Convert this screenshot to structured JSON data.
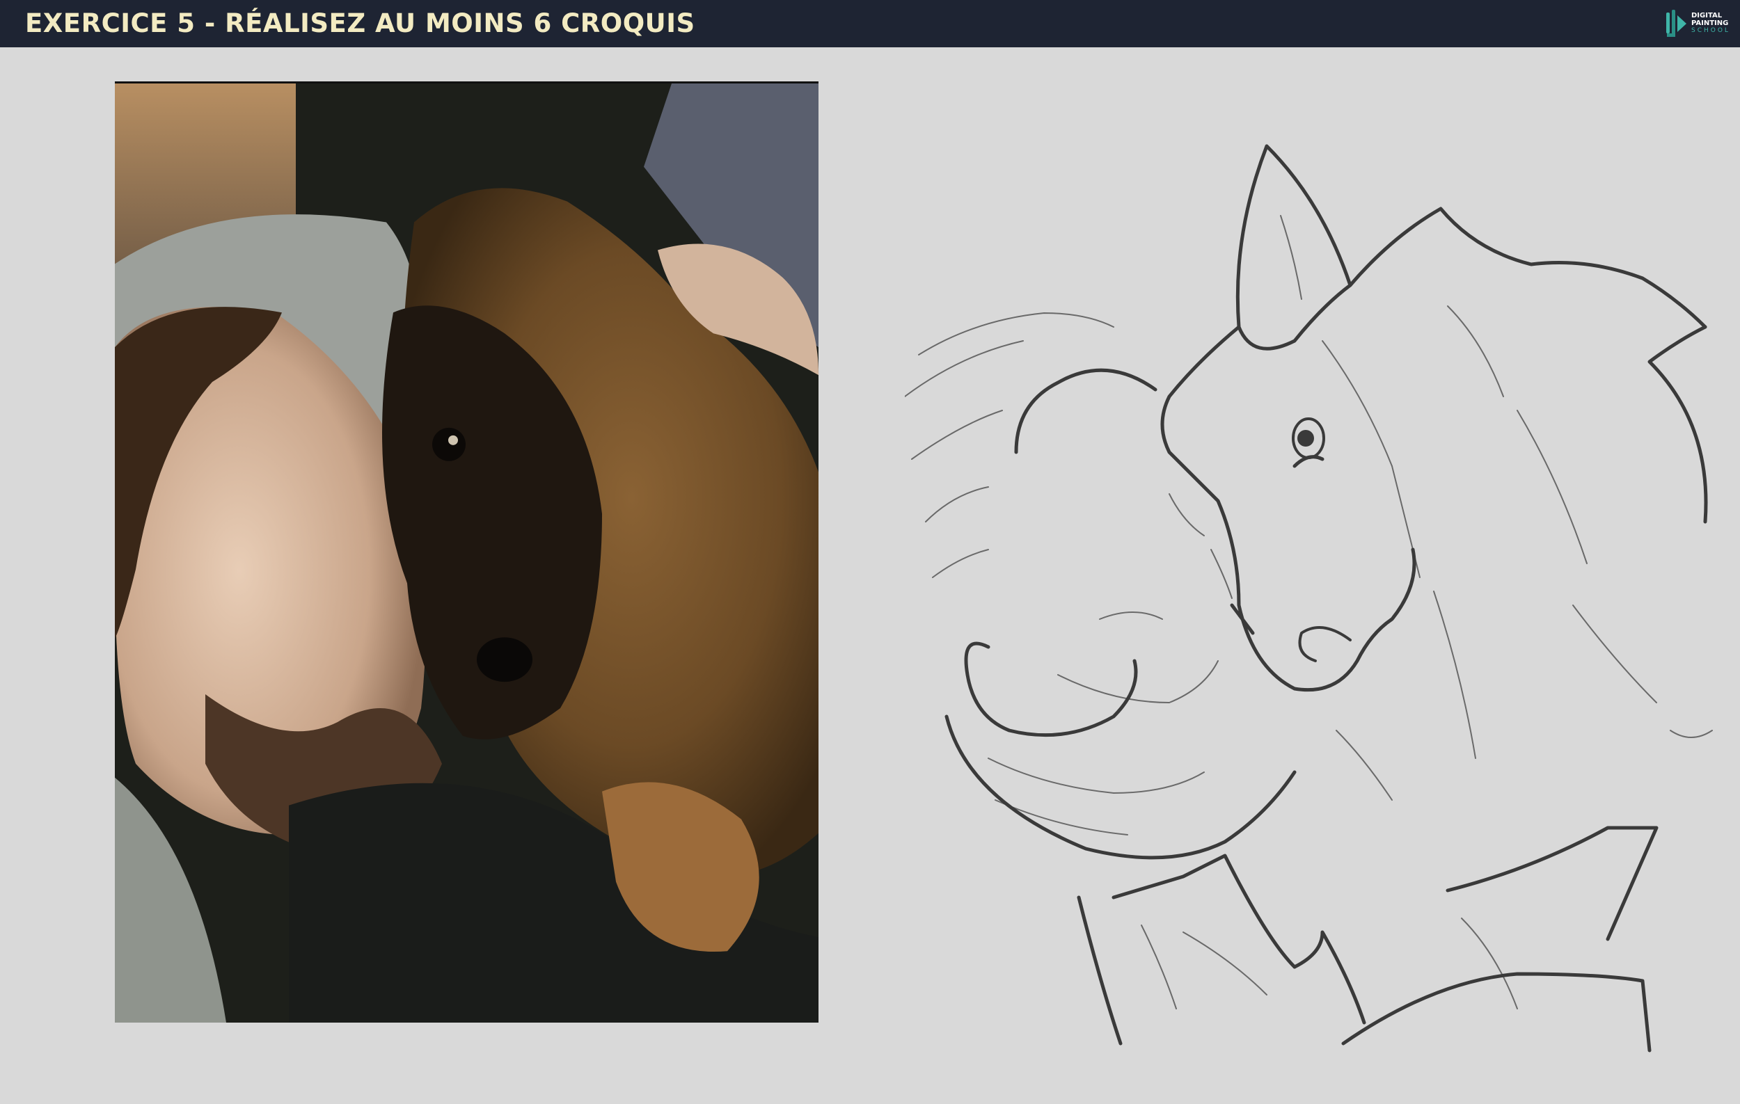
{
  "header": {
    "title": "EXERCICE 5 - RÉALISEZ AU MOINS 6 CROQUIS",
    "logo": {
      "line1": "DIGITAL",
      "line2": "PAINTING",
      "line3": "SCHOOL"
    }
  },
  "colors": {
    "header_bg": "#1e2433",
    "title": "#f3ebc2",
    "page_bg": "#d9d9d9",
    "logo_accent": "#3fb5a8"
  }
}
